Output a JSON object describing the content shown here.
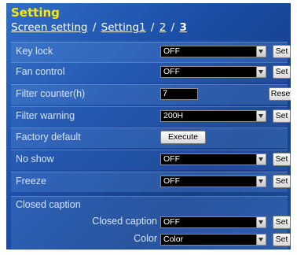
{
  "header": {
    "title": "Setting",
    "breadcrumb": {
      "screen_setting": "Screen setting",
      "separator": "/",
      "setting1": "Setting1",
      "page2": "2",
      "page3": "3"
    }
  },
  "rows": {
    "key_lock": {
      "label": "Key lock",
      "value": "OFF",
      "button": "Set"
    },
    "fan_control": {
      "label": "Fan control",
      "value": "OFF",
      "button": "Set"
    },
    "filter_counter": {
      "label": "Filter counter(h)",
      "value": "7",
      "button": "Reset"
    },
    "filter_warning": {
      "label": "Filter warning",
      "value": "200H",
      "button": "Set"
    },
    "factory_default": {
      "label": "Factory default",
      "button": "Execute"
    },
    "no_show": {
      "label": "No show",
      "value": "OFF",
      "button": "Set"
    },
    "freeze": {
      "label": "Freeze",
      "value": "OFF",
      "button": "Set"
    }
  },
  "closed_caption": {
    "heading": "Closed caption",
    "caption": {
      "label": "Closed caption",
      "value": "OFF",
      "button": "Set"
    },
    "color": {
      "label": "Color",
      "value": "Color",
      "button": "Set"
    }
  },
  "colors": {
    "title": "#ffe800",
    "panel": "#1c4fa8",
    "field_bg": "#000000"
  }
}
